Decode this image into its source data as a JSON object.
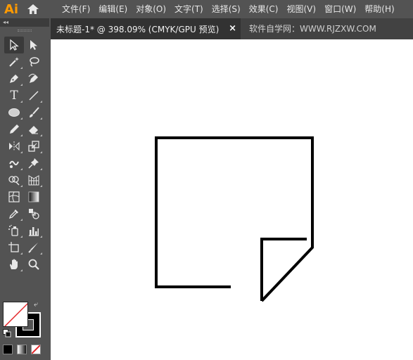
{
  "app": {
    "logo": "Ai"
  },
  "menu": [
    {
      "label": "文件(F)"
    },
    {
      "label": "编辑(E)"
    },
    {
      "label": "对象(O)"
    },
    {
      "label": "文字(T)"
    },
    {
      "label": "选择(S)"
    },
    {
      "label": "效果(C)"
    },
    {
      "label": "视图(V)"
    },
    {
      "label": "窗口(W)"
    },
    {
      "label": "帮助(H)"
    }
  ],
  "document_tab": {
    "title": "未标题-1* @ 398.09% (CMYK/GPU 预览)",
    "close": "×",
    "watermark": "软件自学网：WWW.RJZXW.COM"
  },
  "toolbar": {
    "collapse": "◂◂",
    "tools": [
      [
        "selection-tool",
        "direct-selection-tool"
      ],
      [
        "magic-wand-tool",
        "lasso-tool"
      ],
      [
        "pen-tool",
        "curvature-tool"
      ],
      [
        "type-tool",
        "line-segment-tool"
      ],
      [
        "ellipse-tool",
        "paintbrush-tool"
      ],
      [
        "pencil-tool",
        "eraser-tool"
      ],
      [
        "reflect-tool",
        "scale-tool"
      ],
      [
        "warp-tool",
        "puppet-warp-tool"
      ],
      [
        "shape-builder-tool",
        "perspective-grid-tool"
      ],
      [
        "mesh-tool",
        "gradient-tool"
      ],
      [
        "eyedropper-tool",
        "blend-tool"
      ],
      [
        "symbol-sprayer-tool",
        "column-graph-tool"
      ],
      [
        "artboard-tool",
        "slice-tool"
      ],
      [
        "hand-tool",
        "zoom-tool"
      ]
    ],
    "type_glyph": "T"
  },
  "colors": {
    "fill": "#ffffff",
    "stroke": "#000000",
    "app_orange": "#ff9a00",
    "panel_bg": "#535353"
  }
}
